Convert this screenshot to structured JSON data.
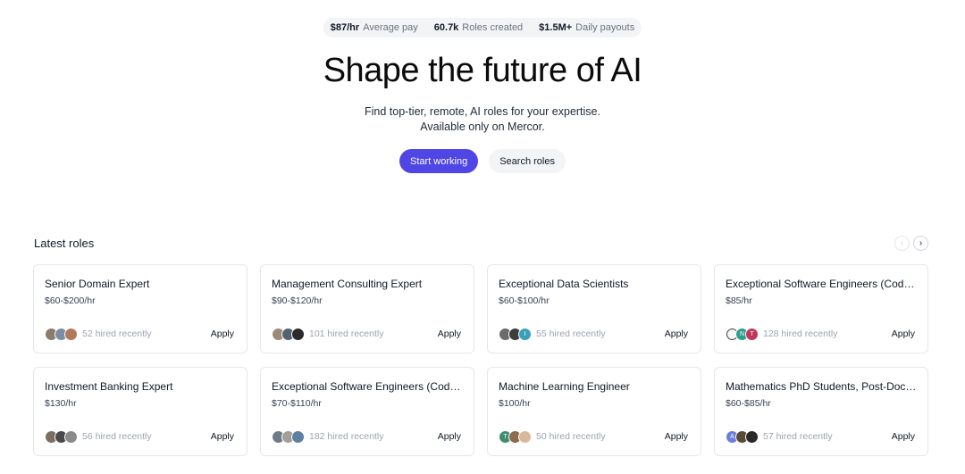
{
  "stats": [
    {
      "value": "$87/hr",
      "label": "Average pay"
    },
    {
      "value": "60.7k",
      "label": "Roles created"
    },
    {
      "value": "$1.5M+",
      "label": "Daily payouts"
    }
  ],
  "hero": {
    "title": "Shape the future of AI",
    "subtitle_line1": "Find top-tier, remote, AI roles for your expertise.",
    "subtitle_line2": "Available only on Mercor.",
    "primary_cta": "Start working",
    "secondary_cta": "Search roles"
  },
  "latest": {
    "title": "Latest roles",
    "prev_icon": "chevron-left-icon",
    "next_icon": "chevron-right-icon",
    "prev_glyph": "‹",
    "next_glyph": "›"
  },
  "roles": [
    {
      "title": "Senior Domain Expert",
      "pay": "$60-$200/hr",
      "hired": "52 hired recently",
      "apply": "Apply",
      "avatars": [
        {
          "color": "#8b7d6b",
          "text": ""
        },
        {
          "color": "#7a8fa6",
          "text": ""
        },
        {
          "color": "#b07a5a",
          "text": ""
        }
      ]
    },
    {
      "title": "Management Consulting Expert",
      "pay": "$90-$120/hr",
      "hired": "101 hired recently",
      "apply": "Apply",
      "avatars": [
        {
          "color": "#9c8a78",
          "text": ""
        },
        {
          "color": "#556270",
          "text": ""
        },
        {
          "color": "#2b2b2b",
          "text": ""
        }
      ]
    },
    {
      "title": "Exceptional Data Scientists",
      "pay": "$60-$100/hr",
      "hired": "55 hired recently",
      "apply": "Apply",
      "avatars": [
        {
          "color": "#6b6b6b",
          "text": ""
        },
        {
          "color": "#3d3d3d",
          "text": ""
        },
        {
          "color": "#3aa0b8",
          "text": "I"
        }
      ]
    },
    {
      "title": "Exceptional Software Engineers (Coding)",
      "pay": "$85/hr",
      "hired": "128 hired recently",
      "apply": "Apply",
      "avatars": [
        {
          "color": "#f5f5f5",
          "text": ""
        },
        {
          "color": "#2f9e8f",
          "text": "N"
        },
        {
          "color": "#c0365a",
          "text": "T"
        }
      ]
    },
    {
      "title": "Investment Banking Expert",
      "pay": "$130/hr",
      "hired": "56 hired recently",
      "apply": "Apply",
      "avatars": [
        {
          "color": "#7d6e62",
          "text": ""
        },
        {
          "color": "#4a4a4a",
          "text": ""
        },
        {
          "color": "#8a8a8a",
          "text": ""
        }
      ]
    },
    {
      "title": "Exceptional Software Engineers (Coding)",
      "pay": "$70-$110/hr",
      "hired": "182 hired recently",
      "apply": "Apply",
      "avatars": [
        {
          "color": "#6f7c88",
          "text": ""
        },
        {
          "color": "#a39e98",
          "text": ""
        },
        {
          "color": "#5d7fa3",
          "text": ""
        }
      ]
    },
    {
      "title": "Machine Learning Engineer",
      "pay": "$100/hr",
      "hired": "50 hired recently",
      "apply": "Apply",
      "avatars": [
        {
          "color": "#3e8e6e",
          "text": "T"
        },
        {
          "color": "#8c6b4f",
          "text": ""
        },
        {
          "color": "#d9b99b",
          "text": ""
        }
      ]
    },
    {
      "title": "Mathematics PhD Students, Post-Docs and Professors",
      "pay": "$60-$85/hr",
      "hired": "57 hired recently",
      "apply": "Apply",
      "avatars": [
        {
          "color": "#6b7fd7",
          "text": "A"
        },
        {
          "color": "#5a4a3a",
          "text": ""
        },
        {
          "color": "#2a2a2a",
          "text": ""
        }
      ]
    }
  ]
}
